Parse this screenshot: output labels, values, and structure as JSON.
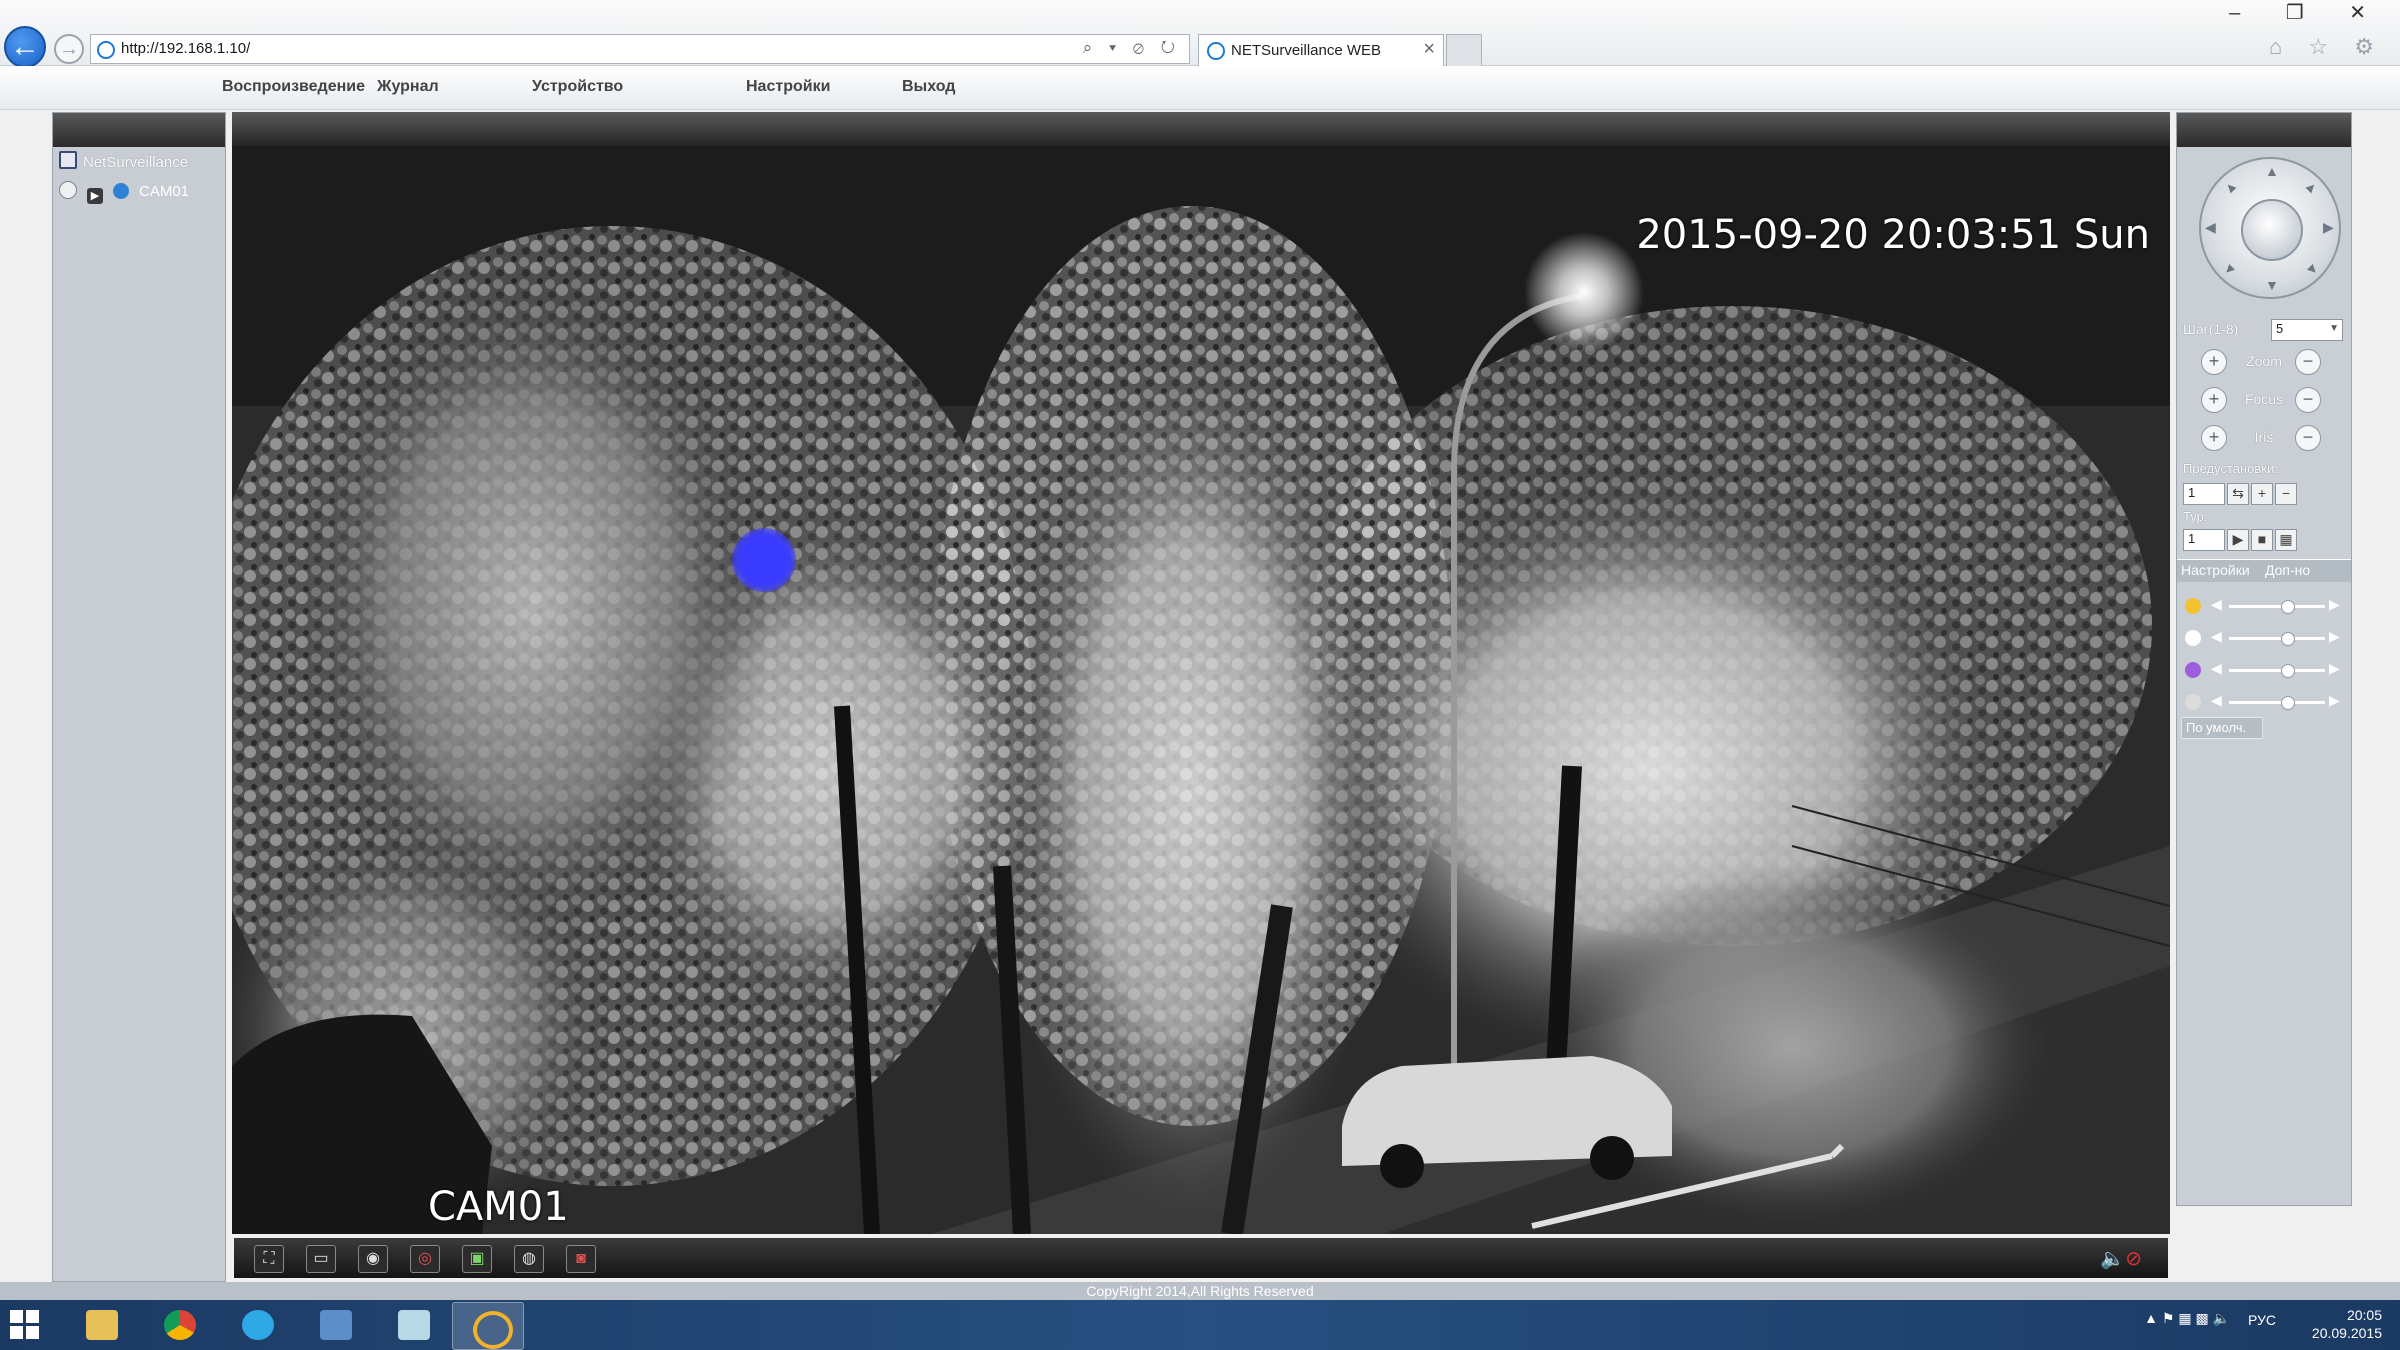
{
  "browser": {
    "url": "http://192.168.1.10/",
    "tab_title": "NETSurveillance WEB",
    "tab_close": "×",
    "window_controls": "– ❐ ✕",
    "address_icons": "⌕ ▾ ⊘ ↻",
    "tools_icons": "⌂ ☆ ⚙"
  },
  "menu": {
    "items": [
      "Воспроизведение",
      "Журнал",
      "Устройство",
      "Настройки",
      "Выход"
    ]
  },
  "tree": {
    "root": "NetSurveillance",
    "camera": "CAM01"
  },
  "video": {
    "timestamp": "2015-09-20 20:03:51 Sun",
    "channel_label": "CAM01"
  },
  "toolbar": {
    "icons": [
      "fullscreen-icon",
      "single-view-icon",
      "record-icon",
      "snapshot-icon",
      "image-icon",
      "talk-icon",
      "stop-icon"
    ],
    "icon_glyphs": [
      "⛶",
      "▭",
      "◉",
      "◎",
      "▣",
      "◍",
      "◙"
    ]
  },
  "ptz": {
    "step_label": "Шаг(1-8):",
    "step_value": "5",
    "zoom_label": "Zoom",
    "focus_label": "Focus",
    "iris_label": "Iris",
    "presets_label": "Предустановки:",
    "preset_value": "1",
    "tour_label": "Тур:",
    "tour_value": "1",
    "tab_settings": "Настройки",
    "tab_extra": "Доп-но",
    "default_button": "По умолч.",
    "sliders": [
      {
        "name": "brightness",
        "color": "#f2c230",
        "level": 0.6
      },
      {
        "name": "contrast",
        "color": "#ffffff",
        "level": 0.6
      },
      {
        "name": "saturation",
        "color": "#9c5dde",
        "level": 0.6
      },
      {
        "name": "hue",
        "color": "#dcdcdc",
        "level": 0.6
      }
    ]
  },
  "footer": {
    "copyright": "CopyRight 2014,All Rights Reserved"
  },
  "taskbar": {
    "language": "РУС",
    "time": "20:05",
    "date": "20.09.2015"
  }
}
